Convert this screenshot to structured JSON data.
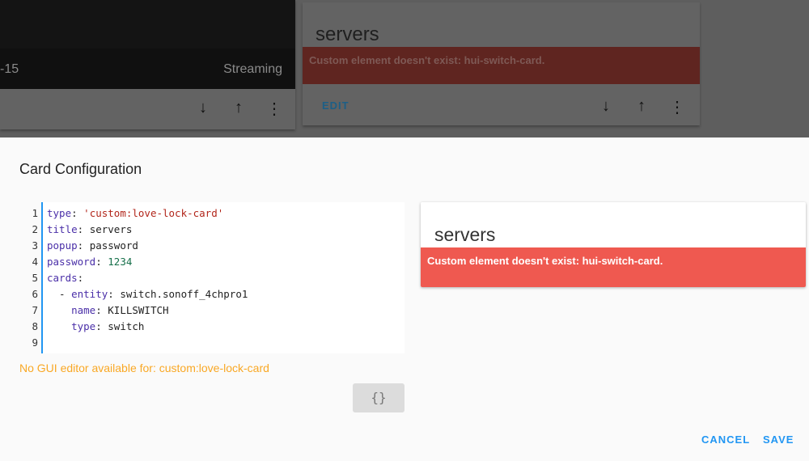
{
  "background": {
    "camera_card": {
      "caption_left": "-15",
      "caption_right": "Streaming",
      "icons": [
        "arrow-down-icon",
        "arrow-up-icon",
        "more-vert-icon"
      ]
    },
    "servers_card": {
      "title": "servers",
      "error": "Custom element doesn't exist: hui-switch-card.",
      "edit_label": "EDIT"
    }
  },
  "dialog": {
    "title": "Card Configuration",
    "editor": {
      "line_numbers": [
        "1",
        "2",
        "3",
        "4",
        "5",
        "6",
        "7",
        "8",
        "9"
      ]
    },
    "warning": "No GUI editor available for: custom:love-lock-card",
    "toggle_label": "{}",
    "preview": {
      "title": "servers",
      "error": "Custom element doesn't exist: hui-switch-card."
    },
    "cancel_label": "CANCEL",
    "save_label": "SAVE"
  },
  "code": {
    "l1k": "type",
    "l1v": "'custom:love-lock-card'",
    "l2k": "title",
    "l2v": "servers",
    "l3k": "popup",
    "l3v": "password",
    "l4k": "password",
    "l4v": "1234",
    "l5k": "cards",
    "l6k": "entity",
    "l6v": "switch.sonoff_4chpro1",
    "l7k": "name",
    "l7v": "KILLSWITCH",
    "l8k": "type",
    "l8v": "switch"
  }
}
